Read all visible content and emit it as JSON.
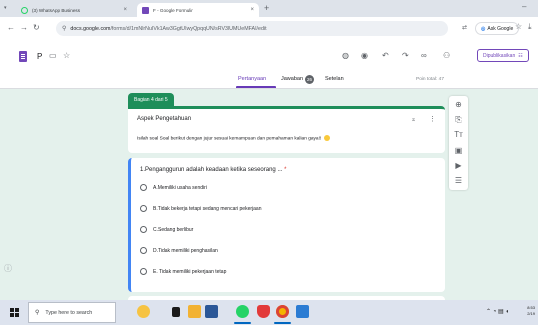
{
  "browser": {
    "tabs": [
      {
        "title": "(3) WhatsApp Business",
        "icon": "whatsapp-icon"
      },
      {
        "title": "F - Google Formulir",
        "icon": "google-forms-icon"
      }
    ],
    "url_host": "docs.google.com",
    "url_path": "/forms/d/1mNlrNuIVk1Aw3GgtUIwyQpqqUN/sRV3lUMUeMFAI/edit",
    "ask_google_label": "Ask Google",
    "new_tab_symbol": "+",
    "close_symbol": "×"
  },
  "form": {
    "title": "P",
    "publish_label": "Dipublikasikan",
    "tabs": {
      "questions": "Pertanyaan",
      "responses": "Jawaban",
      "responses_count": "26",
      "settings": "Setelan"
    },
    "points_total": "Poin total: 47"
  },
  "section": {
    "badge": "Bagian 4 dari 5",
    "title": "Aspek Pengetahuan",
    "description": "Isilah soal Soal berikut dengan jujur sesuai kemampuan dan pemahaman kalian gaya!!"
  },
  "question": {
    "title": "1.Penganggurun adalah keadaan ketika seseorang ...",
    "required_mark": "*",
    "options": [
      "A.Memiliki usaha sendiri",
      "B.Tidak bekerja tetapi sedang mencari pekerjaan",
      "C.Sedang berlibur",
      "D.Tidak memiliki penghasilan",
      "E. Tidak memiliki pekerjaan tetap"
    ]
  },
  "taskbar": {
    "search_placeholder": "Type here to search",
    "clock_time": "8:53",
    "clock_date": "2/19"
  },
  "colors": {
    "forms_purple": "#673ab7",
    "section_green": "#1e8e5a",
    "canvas_bg": "#e4f1ec",
    "question_accent": "#4285f4"
  }
}
